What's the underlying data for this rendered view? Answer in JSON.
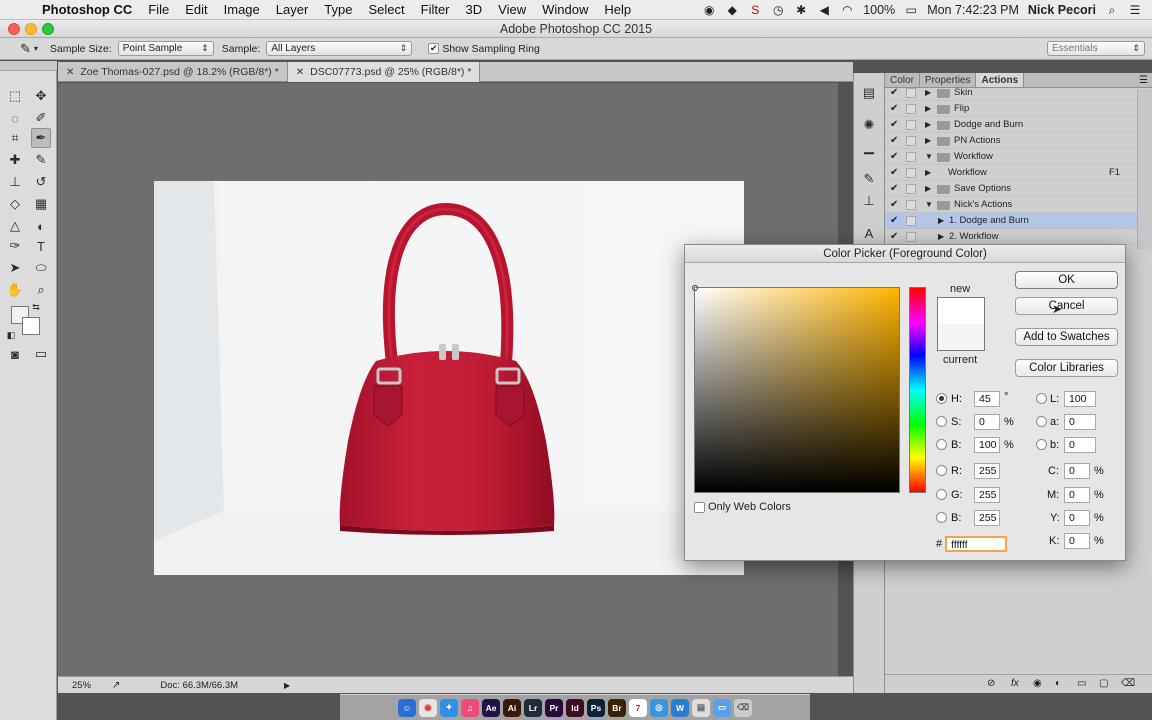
{
  "menubar": {
    "app_name": "Photoshop CC",
    "items": [
      "File",
      "Edit",
      "Image",
      "Layer",
      "Type",
      "Select",
      "Filter",
      "3D",
      "View",
      "Window",
      "Help"
    ],
    "battery": "100%",
    "clock": "Mon 7:42:23 PM",
    "user": "Nick Pecori"
  },
  "window": {
    "title": "Adobe Photoshop CC 2015"
  },
  "options_bar": {
    "sample_size_label": "Sample Size:",
    "sample_size_value": "Point Sample",
    "sample_label": "Sample:",
    "sample_value": "All Layers",
    "sampling_ring_label": "Show Sampling Ring",
    "workspace": "Essentials"
  },
  "tabs": [
    {
      "label": "Zoe Thomas-027.psd @ 18.2% (RGB/8*) *",
      "active": false
    },
    {
      "label": "DSC07773.psd @ 25% (RGB/8*) *",
      "active": true
    }
  ],
  "status_bar": {
    "zoom": "25%",
    "doc_info": "Doc: 66.3M/66.3M"
  },
  "panel": {
    "tabs": [
      "Color",
      "Properties",
      "Actions"
    ],
    "active_tab": "Actions",
    "actions": [
      {
        "label": "Skin",
        "type": "set",
        "expanded": false,
        "checked": true
      },
      {
        "label": "Flip",
        "type": "set",
        "expanded": false,
        "checked": true
      },
      {
        "label": "Dodge and Burn",
        "type": "set",
        "expanded": false,
        "checked": true
      },
      {
        "label": "PN Actions",
        "type": "set",
        "expanded": false,
        "checked": true
      },
      {
        "label": "Workflow",
        "type": "set",
        "expanded": true,
        "checked": true
      },
      {
        "label": "Workflow",
        "type": "action",
        "expanded": false,
        "checked": true,
        "shortcut": "F1"
      },
      {
        "label": "Save Options",
        "type": "set",
        "expanded": false,
        "checked": true
      },
      {
        "label": "Nick's Actions",
        "type": "set",
        "expanded": true,
        "checked": true
      },
      {
        "label": "1. Dodge and Burn",
        "type": "action",
        "expanded": false,
        "checked": true,
        "selected": true
      },
      {
        "label": "2. Workflow",
        "type": "action",
        "expanded": false,
        "checked": true
      }
    ]
  },
  "color_picker": {
    "title": "Color Picker (Foreground Color)",
    "buttons": {
      "ok": "OK",
      "cancel": "Cancel",
      "add_swatches": "Add to Swatches",
      "color_libraries": "Color Libraries"
    },
    "new_label": "new",
    "current_label": "current",
    "only_web_colors": "Only Web Colors",
    "hsb": {
      "h_label": "H:",
      "h": "45",
      "h_unit": "°",
      "s_label": "S:",
      "s": "0",
      "s_unit": "%",
      "b_label": "B:",
      "b": "100",
      "b_unit": "%"
    },
    "rgb": {
      "r_label": "R:",
      "r": "255",
      "g_label": "G:",
      "g": "255",
      "b_label": "B:",
      "b": "255"
    },
    "lab": {
      "l_label": "L:",
      "l": "100",
      "a_label": "a:",
      "a": "0",
      "b_label": "b:",
      "b": "0"
    },
    "cmyk": {
      "c_label": "C:",
      "c": "0",
      "m_label": "M:",
      "m": "0",
      "y_label": "Y:",
      "y": "0",
      "k_label": "K:",
      "k": "0",
      "unit": "%"
    },
    "hex_label": "#",
    "hex": "ffffff",
    "new_color": "#ffffff",
    "current_color": "#f5f5f5"
  },
  "dock_apps": [
    {
      "label": "Ae",
      "color": "#1f1347"
    },
    {
      "label": "Ai",
      "color": "#3b1906"
    },
    {
      "label": "Lr",
      "color": "#1e2b3b"
    },
    {
      "label": "Pr",
      "color": "#2a0a3d"
    },
    {
      "label": "Id",
      "color": "#3e0c22"
    },
    {
      "label": "Ps",
      "color": "#0b2238"
    },
    {
      "label": "Br",
      "color": "#3a2106"
    }
  ]
}
